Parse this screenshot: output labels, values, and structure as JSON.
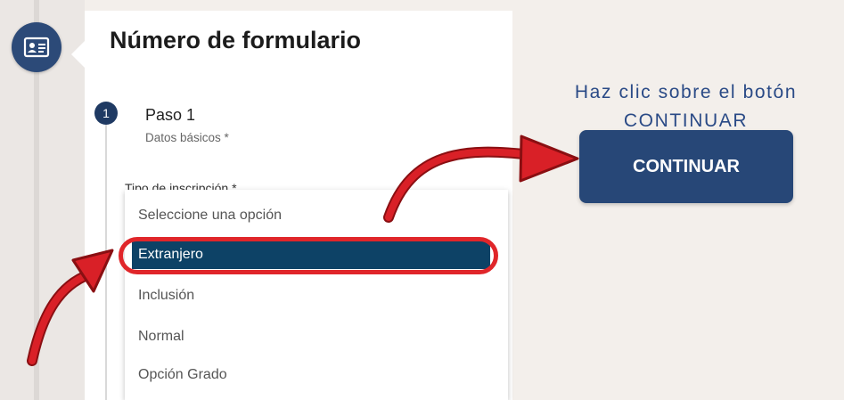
{
  "form": {
    "title": "Número de formulario",
    "step": {
      "number": "1",
      "title": "Paso 1",
      "subtitle": "Datos básicos *"
    },
    "field": {
      "label": "Tipo de inscripción *",
      "options": [
        "Seleccione una opción",
        "Extranjero",
        "Inclusión",
        "Normal",
        "Opción Grado"
      ],
      "selected_index": 1
    }
  },
  "callout": {
    "line1": "Haz clic sobre el botón",
    "line2": "CONTINUAR"
  },
  "continue_button": {
    "label": "CONTINUAR"
  },
  "colors": {
    "primary": "#274777",
    "selected_option": "#0d4266",
    "highlight": "#e0262a",
    "callout_text": "#2a4a86"
  },
  "icons": [
    "id-card-icon",
    "arrow-icon"
  ]
}
